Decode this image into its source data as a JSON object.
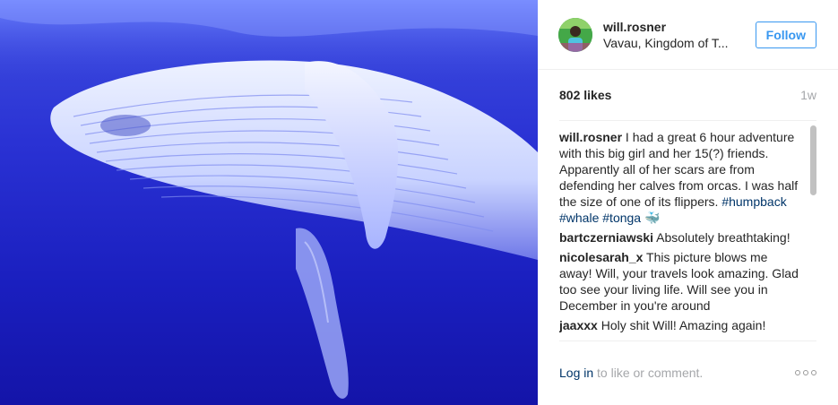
{
  "photo": {
    "alt_subject": "humpback-whale"
  },
  "header": {
    "username": "will.rosner",
    "location": "Vavau, Kingdom of T...",
    "follow_label": "Follow"
  },
  "stats": {
    "likes": "802 likes",
    "time": "1w"
  },
  "caption": {
    "user": "will.rosner",
    "text": " I had a great 6 hour adventure with this big girl and her 15(?) friends. Apparently all of her scars are from defending her calves from orcas. I was half the size of one of its flippers. ",
    "tags": [
      "#humpback",
      "#whale",
      "#tonga"
    ],
    "emoji": "🐳"
  },
  "comments": [
    {
      "user": "bartczerniawski",
      "text": " Absolutely breathtaking!"
    },
    {
      "user": "nicolesarah_x",
      "text": " This picture blows me away! Will, your travels look amazing. Glad too see your living life. Will see you in December in you're around"
    },
    {
      "user": "jaaxxx",
      "text": " Holy shit Will! Amazing again!"
    }
  ],
  "footer": {
    "login_label": "Log in",
    "suffix": " to like or comment.",
    "more_icon": "more-options-icon"
  },
  "colors": {
    "accent": "#3897f0",
    "link": "#003569",
    "muted": "#a5a7aa",
    "water": "#2a32d4"
  }
}
